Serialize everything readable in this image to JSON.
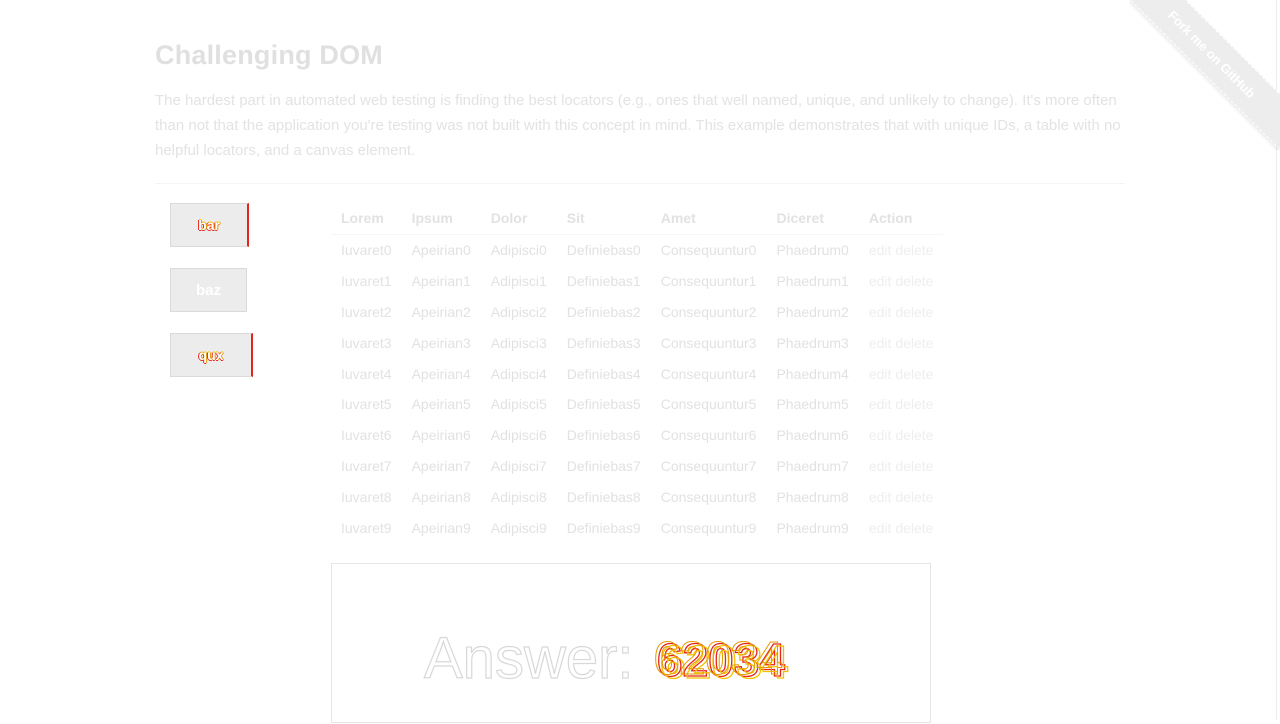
{
  "ribbon": {
    "label": "Fork me on GitHub"
  },
  "page": {
    "title": "Challenging DOM",
    "intro": "The hardest part in automated web testing is finding the best locators (e.g., ones that well named, unique, and unlikely to change). It's more often than not that the application you're testing was not built with this concept in mind. This example demonstrates that with unique IDs, a table with no helpful locators, and a canvas element."
  },
  "buttons": [
    {
      "label": "bar",
      "accent": "#e8231a"
    },
    {
      "label": "baz"
    },
    {
      "label": "qux",
      "accent": "#e8231a"
    }
  ],
  "table": {
    "headers": [
      "Lorem",
      "Ipsum",
      "Dolor",
      "Sit",
      "Amet",
      "Diceret",
      "Action"
    ],
    "rows": [
      [
        "Iuvaret0",
        "Apeirian0",
        "Adipisci0",
        "Definiebas0",
        "Consequuntur0",
        "Phaedrum0"
      ],
      [
        "Iuvaret1",
        "Apeirian1",
        "Adipisci1",
        "Definiebas1",
        "Consequuntur1",
        "Phaedrum1"
      ],
      [
        "Iuvaret2",
        "Apeirian2",
        "Adipisci2",
        "Definiebas2",
        "Consequuntur2",
        "Phaedrum2"
      ],
      [
        "Iuvaret3",
        "Apeirian3",
        "Adipisci3",
        "Definiebas3",
        "Consequuntur3",
        "Phaedrum3"
      ],
      [
        "Iuvaret4",
        "Apeirian4",
        "Adipisci4",
        "Definiebas4",
        "Consequuntur4",
        "Phaedrum4"
      ],
      [
        "Iuvaret5",
        "Apeirian5",
        "Adipisci5",
        "Definiebas5",
        "Consequuntur5",
        "Phaedrum5"
      ],
      [
        "Iuvaret6",
        "Apeirian6",
        "Adipisci6",
        "Definiebas6",
        "Consequuntur6",
        "Phaedrum6"
      ],
      [
        "Iuvaret7",
        "Apeirian7",
        "Adipisci7",
        "Definiebas7",
        "Consequuntur7",
        "Phaedrum7"
      ],
      [
        "Iuvaret8",
        "Apeirian8",
        "Adipisci8",
        "Definiebas8",
        "Consequuntur8",
        "Phaedrum8"
      ],
      [
        "Iuvaret9",
        "Apeirian9",
        "Adipisci9",
        "Definiebas9",
        "Consequuntur9",
        "Phaedrum9"
      ]
    ],
    "action_edit": "edit",
    "action_delete": "delete"
  },
  "canvas": {
    "answer_label": "Answer:",
    "answer_value": "62034",
    "scribble_colors": [
      "#e8231a",
      "#f2c200",
      "#e39a00"
    ]
  }
}
